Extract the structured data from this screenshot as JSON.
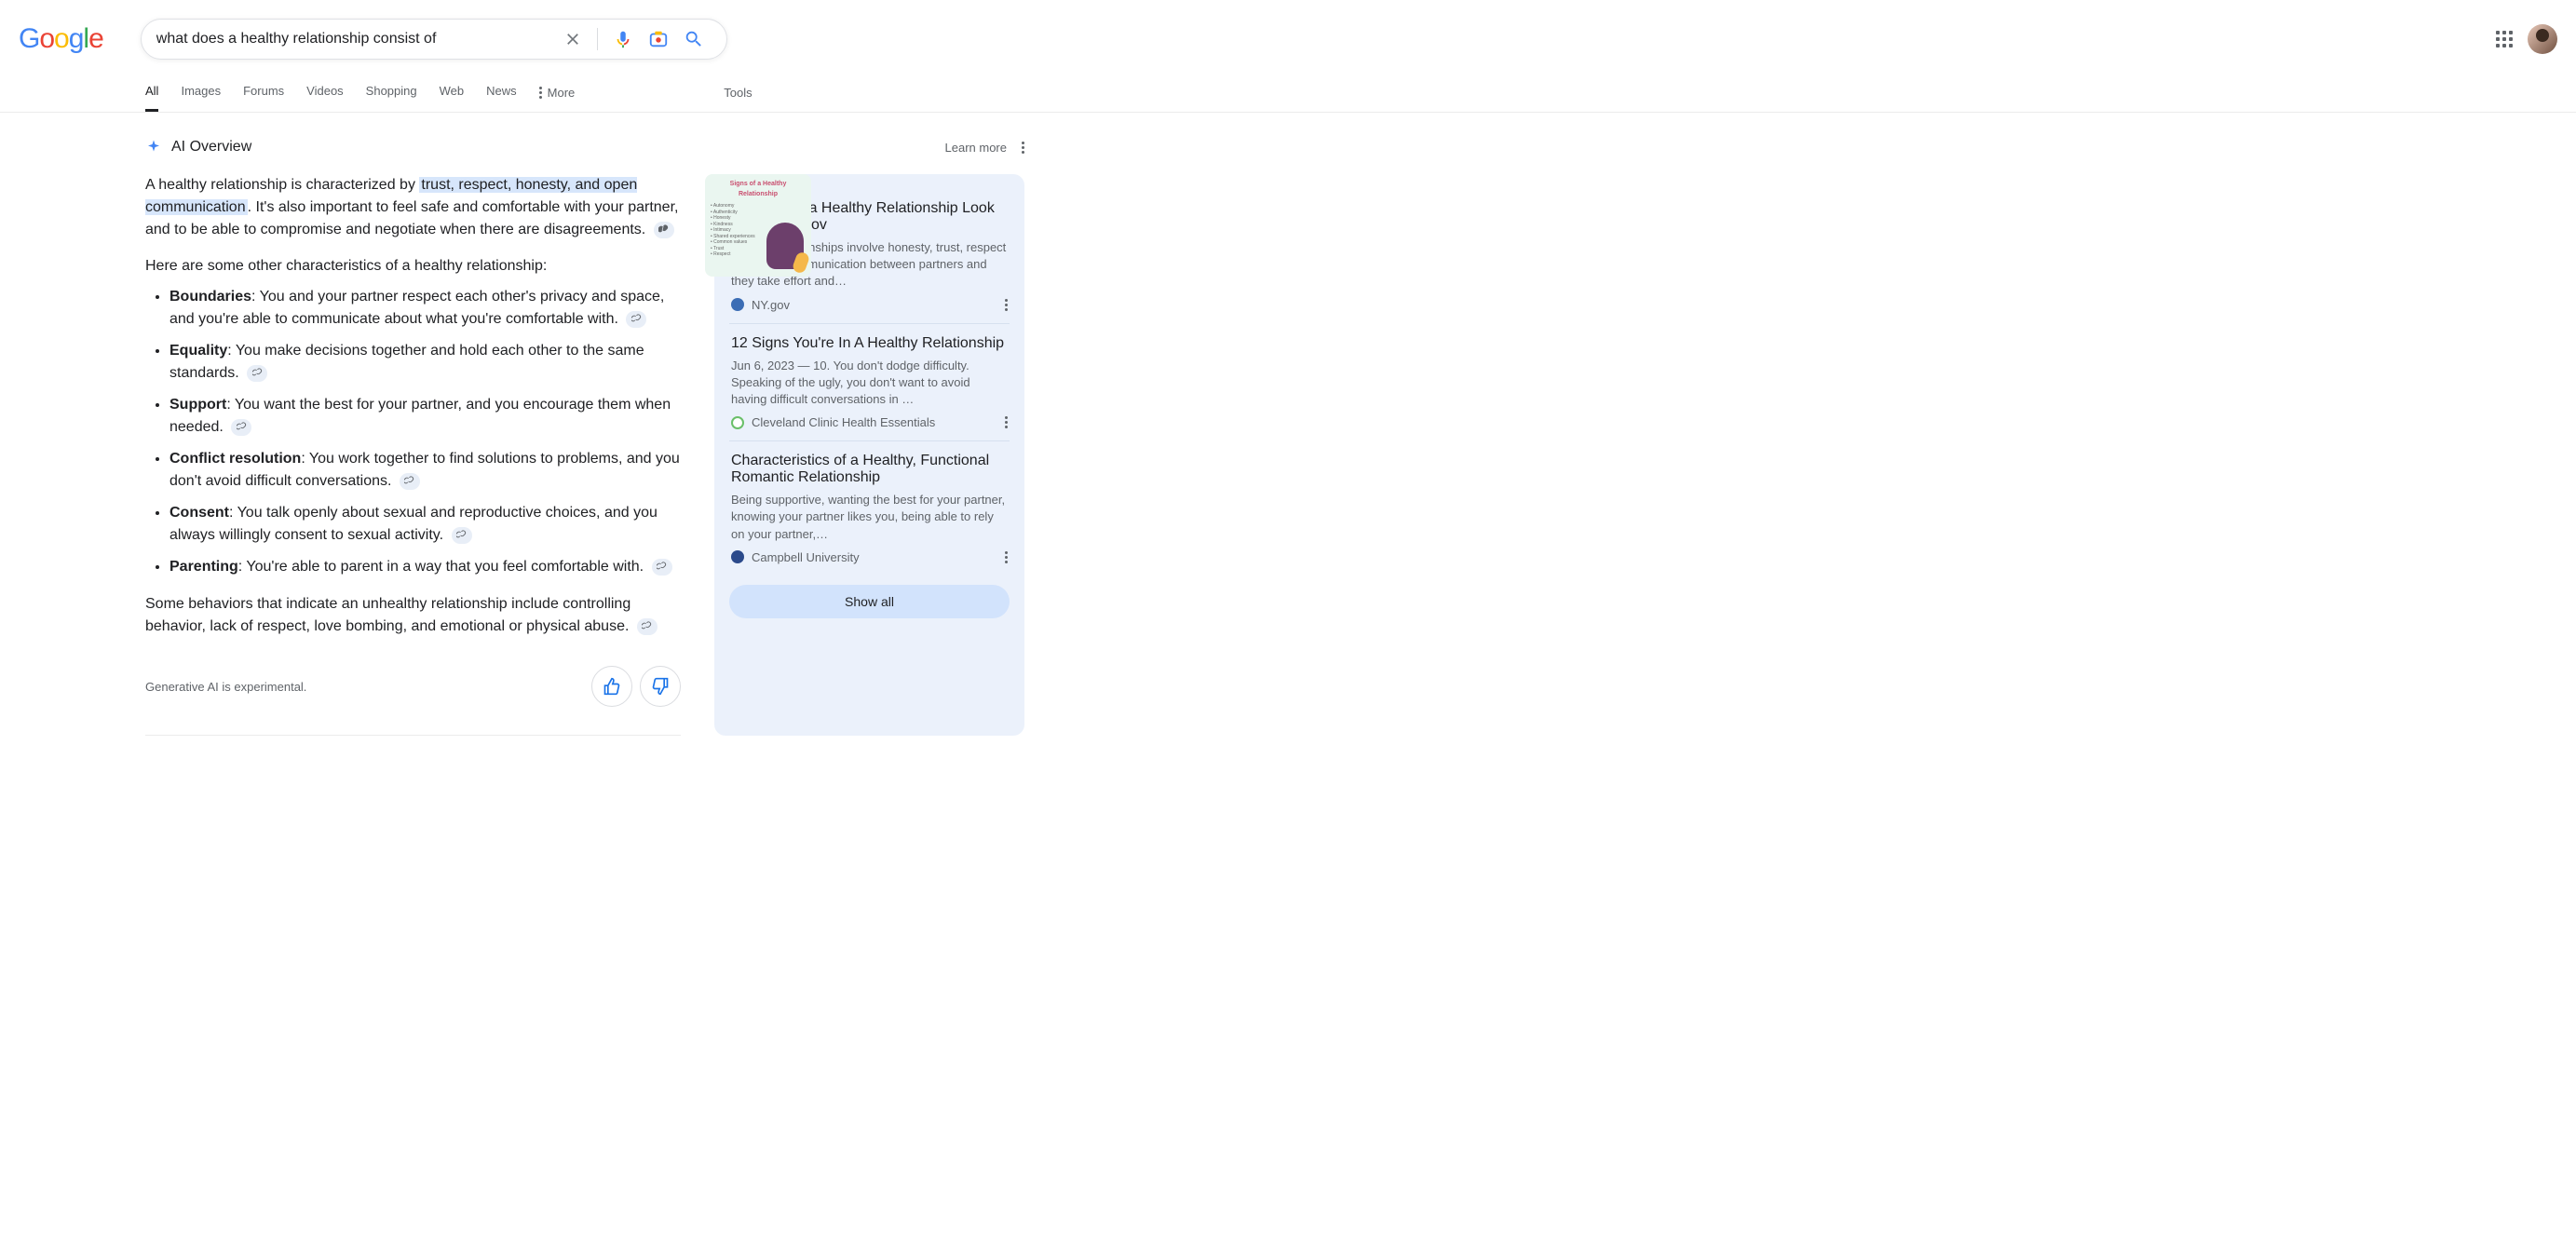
{
  "search": {
    "query": "what does a healthy relationship consist of"
  },
  "tabs": {
    "all": "All",
    "images": "Images",
    "forums": "Forums",
    "videos": "Videos",
    "shopping": "Shopping",
    "web": "Web",
    "news": "News",
    "more": "More",
    "tools": "Tools"
  },
  "ai": {
    "title": "AI Overview",
    "learn_more": "Learn more",
    "summary_prefix": "A healthy relationship is characterized by ",
    "summary_highlight": "trust, respect, honesty, and open communication",
    "summary_suffix": ". It's also important to feel safe and comfortable with your partner, and to be able to compromise and negotiate when there are disagreements.",
    "subhead": "Here are some other characteristics of a healthy relationship:",
    "items": [
      {
        "term": "Boundaries",
        "desc": ": You and your partner respect each other's privacy and space, and you're able to communicate about what you're comfortable with."
      },
      {
        "term": "Equality",
        "desc": ": You make decisions together and hold each other to the same standards."
      },
      {
        "term": "Support",
        "desc": ": You want the best for your partner, and you encourage them when needed."
      },
      {
        "term": "Conflict resolution",
        "desc": ": You work together to find solutions to problems, and you don't avoid difficult conversations."
      },
      {
        "term": "Consent",
        "desc": ": You talk openly about sexual and reproductive choices, and you always willingly consent to sexual activity."
      },
      {
        "term": "Parenting",
        "desc": ": You're able to parent in a way that you feel comfortable with."
      }
    ],
    "summary2": "Some behaviors that indicate an unhealthy relationship include controlling behavior, lack of respect, love bombing, and emotional or physical abuse.",
    "thumb_title": "Signs of a Healthy Relationship",
    "disclaimer": "Generative AI is experimental."
  },
  "sources": [
    {
      "title": "What Does a Healthy Relationship Look Like? - NY.gov",
      "snippet": "Healthy relationships involve honesty, trust, respect and open communication between partners and they take effort and…",
      "site": "NY.gov"
    },
    {
      "title": "12 Signs You're In A Healthy Relationship",
      "snippet": "Jun 6, 2023 — 10. You don't dodge difficulty. Speaking of the ugly, you don't want to avoid having difficult conversations in …",
      "site": "Cleveland Clinic Health Essentials"
    },
    {
      "title": "Characteristics of a Healthy, Functional Romantic Relationship",
      "snippet": "Being supportive, wanting the best for your partner, knowing your partner likes you, being able to rely on your partner,…",
      "site": "Campbell University"
    }
  ],
  "show_all": "Show all"
}
